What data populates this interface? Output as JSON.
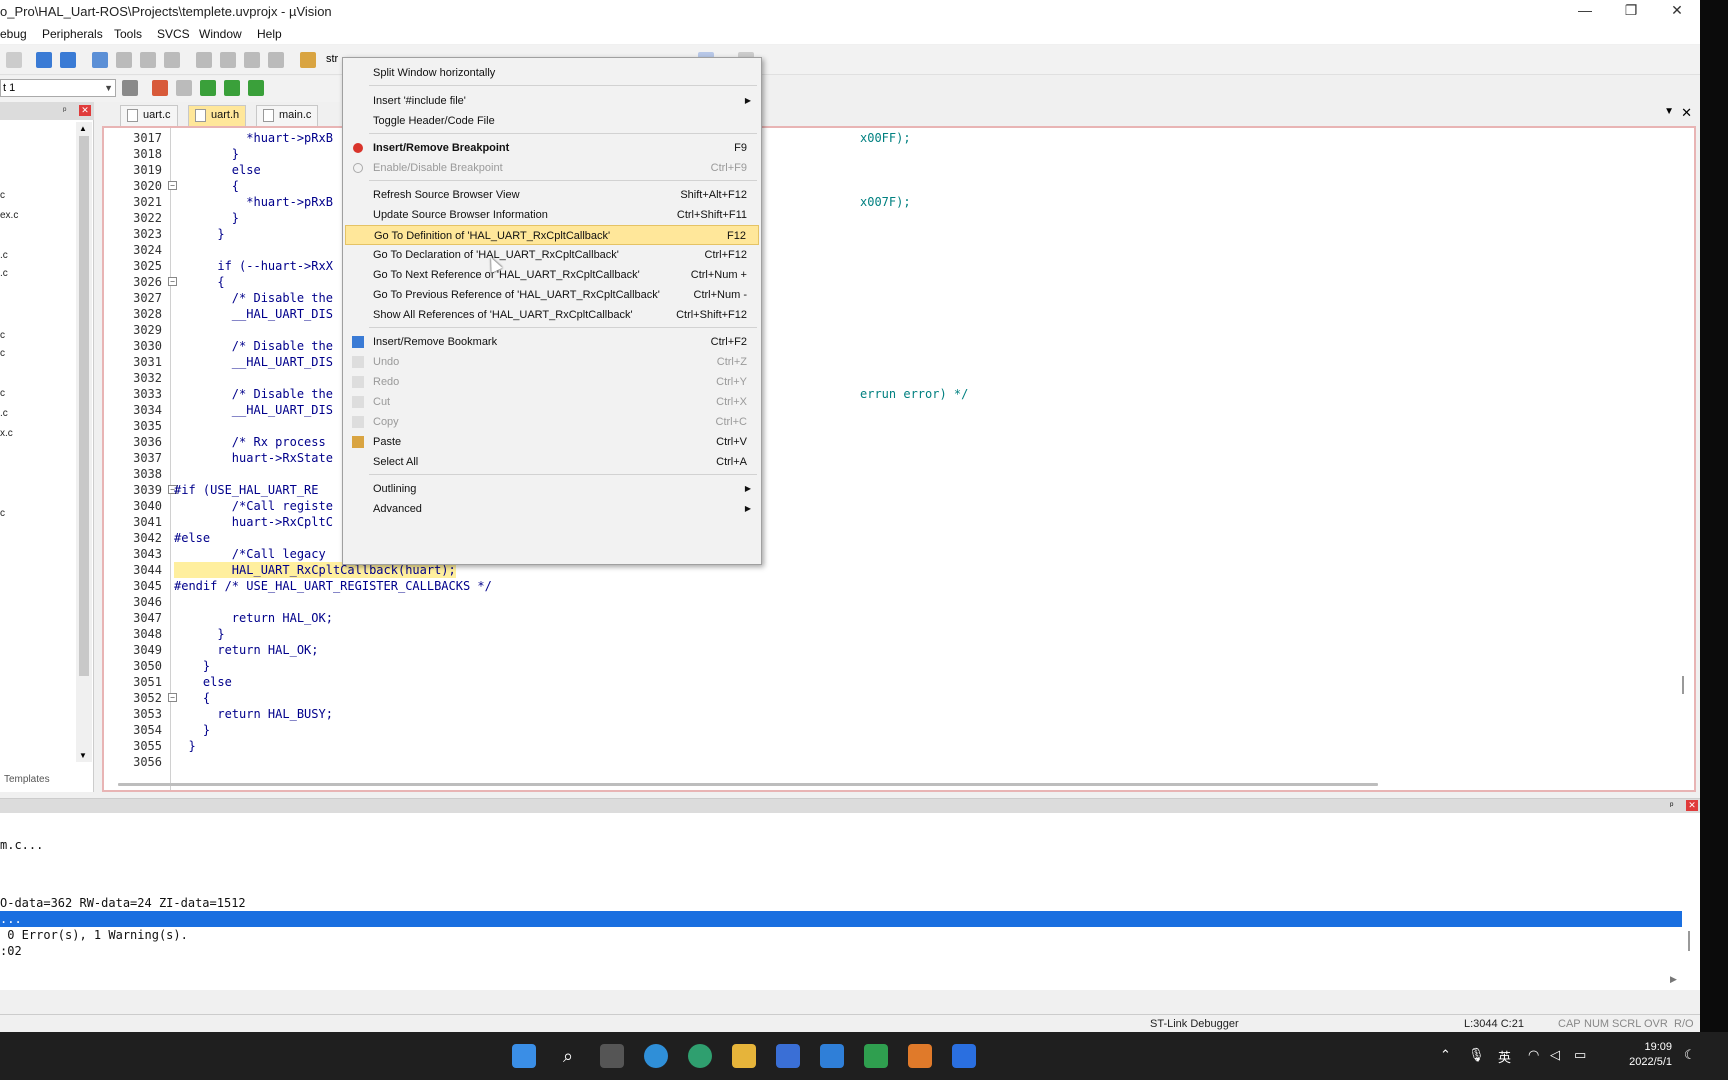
{
  "window": {
    "title": "o_Pro\\HAL_Uart-ROS\\Projects\\templete.uvprojx - µVision",
    "minimize": "—",
    "restore": "❐",
    "close": "✕"
  },
  "menubar": {
    "items": [
      "ebug",
      "Peripherals",
      "Tools",
      "SVCS",
      "Window",
      "Help"
    ]
  },
  "toolbar": {
    "target_label": "t 1",
    "search_text": "str"
  },
  "project_pane": {
    "tree_items": [
      "c",
      "ex.c",
      ".c",
      ".c",
      "c",
      "c",
      "c",
      ".c",
      "x.c",
      "c"
    ],
    "templates_tab": "Templates"
  },
  "editor": {
    "tabs": [
      {
        "label": "uart.c",
        "active": false
      },
      {
        "label": "uart.h",
        "active": true
      },
      {
        "label": "main.c",
        "active": false
      }
    ],
    "lines": [
      {
        "n": "3017",
        "code": "          *huart->pRxB",
        "tail": "x00FF);"
      },
      {
        "n": "3018",
        "code": "        }",
        "tail": ""
      },
      {
        "n": "3019",
        "code": "        else",
        "tail": ""
      },
      {
        "n": "3020",
        "code": "        {",
        "tail": ""
      },
      {
        "n": "3021",
        "code": "          *huart->pRxB",
        "tail": "x007F);"
      },
      {
        "n": "3022",
        "code": "        }",
        "tail": ""
      },
      {
        "n": "3023",
        "code": "      }",
        "tail": ""
      },
      {
        "n": "3024",
        "code": "",
        "tail": ""
      },
      {
        "n": "3025",
        "code": "      if (--huart->RxX",
        "tail": ""
      },
      {
        "n": "3026",
        "code": "      {",
        "tail": ""
      },
      {
        "n": "3027",
        "code": "        /* Disable the",
        "tail": ""
      },
      {
        "n": "3028",
        "code": "        __HAL_UART_DIS",
        "tail": ""
      },
      {
        "n": "3029",
        "code": "",
        "tail": ""
      },
      {
        "n": "3030",
        "code": "        /* Disable the",
        "tail": ""
      },
      {
        "n": "3031",
        "code": "        __HAL_UART_DIS",
        "tail": ""
      },
      {
        "n": "3032",
        "code": "",
        "tail": ""
      },
      {
        "n": "3033",
        "code": "        /* Disable the",
        "tail": "errun error) */"
      },
      {
        "n": "3034",
        "code": "        __HAL_UART_DIS",
        "tail": ""
      },
      {
        "n": "3035",
        "code": "",
        "tail": ""
      },
      {
        "n": "3036",
        "code": "        /* Rx process",
        "tail": ""
      },
      {
        "n": "3037",
        "code": "        huart->RxState",
        "tail": ""
      },
      {
        "n": "3038",
        "code": "",
        "tail": ""
      },
      {
        "n": "3039",
        "code": "#if (USE_HAL_UART_RE",
        "tail": ""
      },
      {
        "n": "3040",
        "code": "        /*Call registe",
        "tail": ""
      },
      {
        "n": "3041",
        "code": "        huart->RxCpltC",
        "tail": ""
      },
      {
        "n": "3042",
        "code": "#else",
        "tail": ""
      },
      {
        "n": "3043",
        "code": "        /*Call legacy",
        "tail": ""
      },
      {
        "n": "3044",
        "code": "        HAL_UART_RxCpltCallback(huart);",
        "tail": ""
      },
      {
        "n": "3045",
        "code": "#endif /* USE_HAL_UART_REGISTER_CALLBACKS */",
        "tail": ""
      },
      {
        "n": "3046",
        "code": "",
        "tail": ""
      },
      {
        "n": "3047",
        "code": "        return HAL_OK;",
        "tail": ""
      },
      {
        "n": "3048",
        "code": "      }",
        "tail": ""
      },
      {
        "n": "3049",
        "code": "      return HAL_OK;",
        "tail": ""
      },
      {
        "n": "3050",
        "code": "    }",
        "tail": ""
      },
      {
        "n": "3051",
        "code": "    else",
        "tail": ""
      },
      {
        "n": "3052",
        "code": "    {",
        "tail": ""
      },
      {
        "n": "3053",
        "code": "      return HAL_BUSY;",
        "tail": ""
      },
      {
        "n": "3054",
        "code": "    }",
        "tail": ""
      },
      {
        "n": "3055",
        "code": "  }",
        "tail": ""
      },
      {
        "n": "3056",
        "code": "",
        "tail": ""
      }
    ]
  },
  "context_menu": {
    "items": [
      {
        "label": "Split Window horizontally",
        "shortcut": ""
      },
      {
        "label": "Insert '#include file'",
        "shortcut": "",
        "submenu": true
      },
      {
        "label": "Toggle Header/Code File",
        "shortcut": ""
      },
      {
        "label": "Insert/Remove Breakpoint",
        "shortcut": "F9"
      },
      {
        "label": "Enable/Disable Breakpoint",
        "shortcut": "Ctrl+F9"
      },
      {
        "label": "Refresh Source Browser View",
        "shortcut": "Shift+Alt+F12"
      },
      {
        "label": "Update Source Browser Information",
        "shortcut": "Ctrl+Shift+F11"
      },
      {
        "label": "Go To Definition of 'HAL_UART_RxCpltCallback'",
        "shortcut": "F12"
      },
      {
        "label": "Go To Declaration of 'HAL_UART_RxCpltCallback'",
        "shortcut": "Ctrl+F12"
      },
      {
        "label": "Go To Next Reference of 'HAL_UART_RxCpltCallback'",
        "shortcut": "Ctrl+Num +"
      },
      {
        "label": "Go To Previous Reference of 'HAL_UART_RxCpltCallback'",
        "shortcut": "Ctrl+Num -"
      },
      {
        "label": "Show All References of 'HAL_UART_RxCpltCallback'",
        "shortcut": "Ctrl+Shift+F12"
      },
      {
        "label": "Insert/Remove Bookmark",
        "shortcut": "Ctrl+F2"
      },
      {
        "label": "Undo",
        "shortcut": "Ctrl+Z"
      },
      {
        "label": "Redo",
        "shortcut": "Ctrl+Y"
      },
      {
        "label": "Cut",
        "shortcut": "Ctrl+X"
      },
      {
        "label": "Copy",
        "shortcut": "Ctrl+C"
      },
      {
        "label": "Paste",
        "shortcut": "Ctrl+V"
      },
      {
        "label": "Select All",
        "shortcut": "Ctrl+A"
      },
      {
        "label": "Outlining",
        "shortcut": "",
        "submenu": true
      },
      {
        "label": "Advanced",
        "shortcut": "",
        "submenu": true
      }
    ]
  },
  "output": {
    "lines": [
      {
        "text": "m.c...",
        "selected": false
      },
      {
        "text": "O-data=362 RW-data=24 ZI-data=1512",
        "selected": false
      },
      {
        "text": "...",
        "selected": true
      },
      {
        "text": " 0 Error(s), 1 Warning(s).",
        "selected": false
      },
      {
        "text": ":02",
        "selected": false
      }
    ]
  },
  "statusbar": {
    "debugger": "ST-Link Debugger",
    "position": "L:3044 C:21",
    "caps": "CAP",
    "num": "NUM",
    "scrl": "SCRL",
    "ovr": "OVR",
    "ro": "R/O"
  },
  "taskbar": {
    "ime": "英",
    "time": "19:09",
    "date": "2022/5/1"
  },
  "colors": {
    "highlight": "#ffe79a",
    "selection_blue": "#1a6fe0",
    "breakpoint_red": "#d9342b"
  }
}
